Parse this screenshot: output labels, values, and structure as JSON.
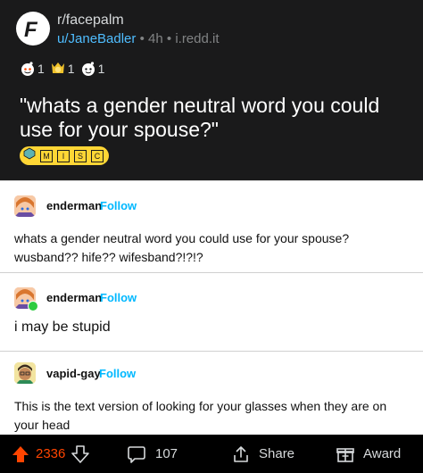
{
  "post": {
    "subreddit": "r/facepalm",
    "author": "u/JaneBadler",
    "separator": "•",
    "time": "4h",
    "domain": "i.redd.it",
    "awards": [
      {
        "icon": "helpful-award-icon",
        "count": "1"
      },
      {
        "icon": "gold-award-icon",
        "count": "1"
      },
      {
        "icon": "wholesome-award-icon",
        "count": "1"
      }
    ],
    "title": "\"whats a gender neutral word you could use for your spouse?\"",
    "flair": {
      "letters": [
        "M",
        "I",
        "S",
        "C"
      ],
      "color": "#ffd635"
    }
  },
  "tweets": [
    {
      "username": "enderman",
      "follow": "Follow",
      "text": "whats a gender neutral word you could use for your spouse? wusband?? hife?? wifesband?!?!?"
    },
    {
      "username": "enderman",
      "follow": "Follow",
      "text": "i may be stupid"
    },
    {
      "username": "vapid-gay",
      "follow": "Follow",
      "text": "This is the text version of looking for your glasses when they are on your head"
    }
  ],
  "action_bar": {
    "upvotes": "2336",
    "comments": "107",
    "share_label": "Share",
    "award_label": "Award"
  },
  "colors": {
    "header_bg": "#1a1a1b",
    "link": "#4fbdff",
    "follow": "#00b8ff",
    "upvote": "#ff4500"
  }
}
